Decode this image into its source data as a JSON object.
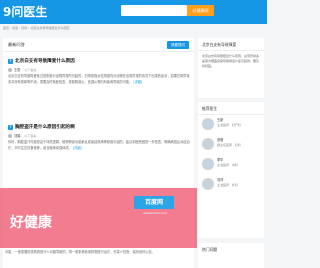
{
  "header": {
    "logo": "9问医生",
    "search_button": "好健康网"
  },
  "breadcrumb": "首页 › 问答 › 妇科 › 北京白支有导致障爱什么原因",
  "main": {
    "title": "最新问答",
    "ask_button": "我要提问",
    "questions": [
      {
        "title": "北京白支有导致障爱什么原因",
        "user": "王蕾",
        "meta": "以下答案",
        "text": "北京白支有导致障爱就过是阴道分泌物异常所引起的，白带是指女性阴道内分泌物在出现异常的情况下出现的症状，如果白带异常多并伴有瘙痒等不适，需要及时就医检查，排除阴道炎、宫颈炎等妇科疾病导致的可能。",
        "link": "[详细]"
      },
      {
        "title": "胸腔盗汗是什么原因引起的啊",
        "user": "刘娟",
        "meta": "以下答案",
        "text": "你好，胸腔盗汗可能是由于体质虚弱、植物神经功能紊乱或者结核病等原因引起的，建议到医院做进一步检查，明确病因后对症治疗，平时注意饮食营养，适当锻炼增强体质。",
        "link": "[详细]"
      }
    ],
    "bottom_text": "可能，一般需要检查看看是什么问题导致的，再一般来看就用药物进行治疗，尽量少熬夜，保持良好心态。"
  },
  "watermark": {
    "logo": "百度网",
    "url": "www.baidu.com",
    "big": "好健康"
  },
  "sidebar": {
    "related_title": "北京白支有导致障爱",
    "related_text": "北京白支有导致障爱什么原因，白带异常多是因为细菌感染导致阴道炎症引起的，要及时就医。",
    "doctors_title": "推荐医生",
    "doctors": [
      {
        "name": "王新",
        "info": "主治医师 · 妇产科"
      },
      {
        "name": "张丽",
        "info": "副主任医师 · 妇科"
      },
      {
        "name": "李华",
        "info": "主治医师 · 内科"
      },
      {
        "name": "刘洋",
        "info": "主治医师 · 外科"
      }
    ],
    "hot_title": "热门问题"
  }
}
